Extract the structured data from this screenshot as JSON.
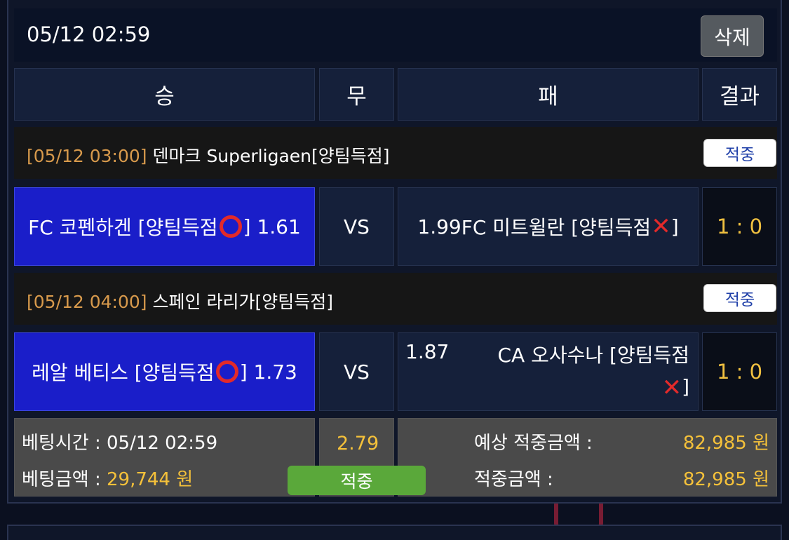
{
  "header": {
    "time": "05/12 02:59",
    "delete_label": "삭제"
  },
  "columns": {
    "win": "승",
    "draw": "무",
    "lose": "패",
    "result": "결과"
  },
  "matches": [
    {
      "date": "[05/12 03:00]",
      "league": " 덴마크 Superligaen[양팀득점]",
      "badge": "적중",
      "home": "FC 코펜하겐 [양팀득점",
      "home_close": "] 1.61",
      "vs": "VS",
      "away_odds": "1.99",
      "away": "FC 미트윌란 [양팀득점",
      "away_close": "]",
      "score": "1 : 0"
    },
    {
      "date": "[05/12 04:00]",
      "league": " 스페인 라리가[양팀득점]",
      "badge": "적중",
      "home": "레알 베티스 [양팀득점",
      "home_close": "] 1.73",
      "vs": "VS",
      "away_odds": "1.87",
      "away": "CA 오사수나 [양팀득점",
      "away_close": "]",
      "score": "1 : 0"
    }
  ],
  "footer": {
    "bet_time_label": "베팅시간 : ",
    "bet_time": "05/12 02:59",
    "bet_amount_label": "베팅금액 : ",
    "bet_amount": "29,744 원",
    "total_odds": "2.79",
    "status": "적중",
    "expected_label": "예상 적중금액 :",
    "expected_value": "82,985 원",
    "win_label": "적중금액 :",
    "win_value": "82,985 원"
  },
  "icons": {
    "hit": "red-circle-icon",
    "miss": "red-x-icon"
  },
  "colors": {
    "home_bg": "#1a1ec9",
    "gold": "#f5c13a",
    "date": "#d89a4c",
    "green": "#5aa83a"
  }
}
